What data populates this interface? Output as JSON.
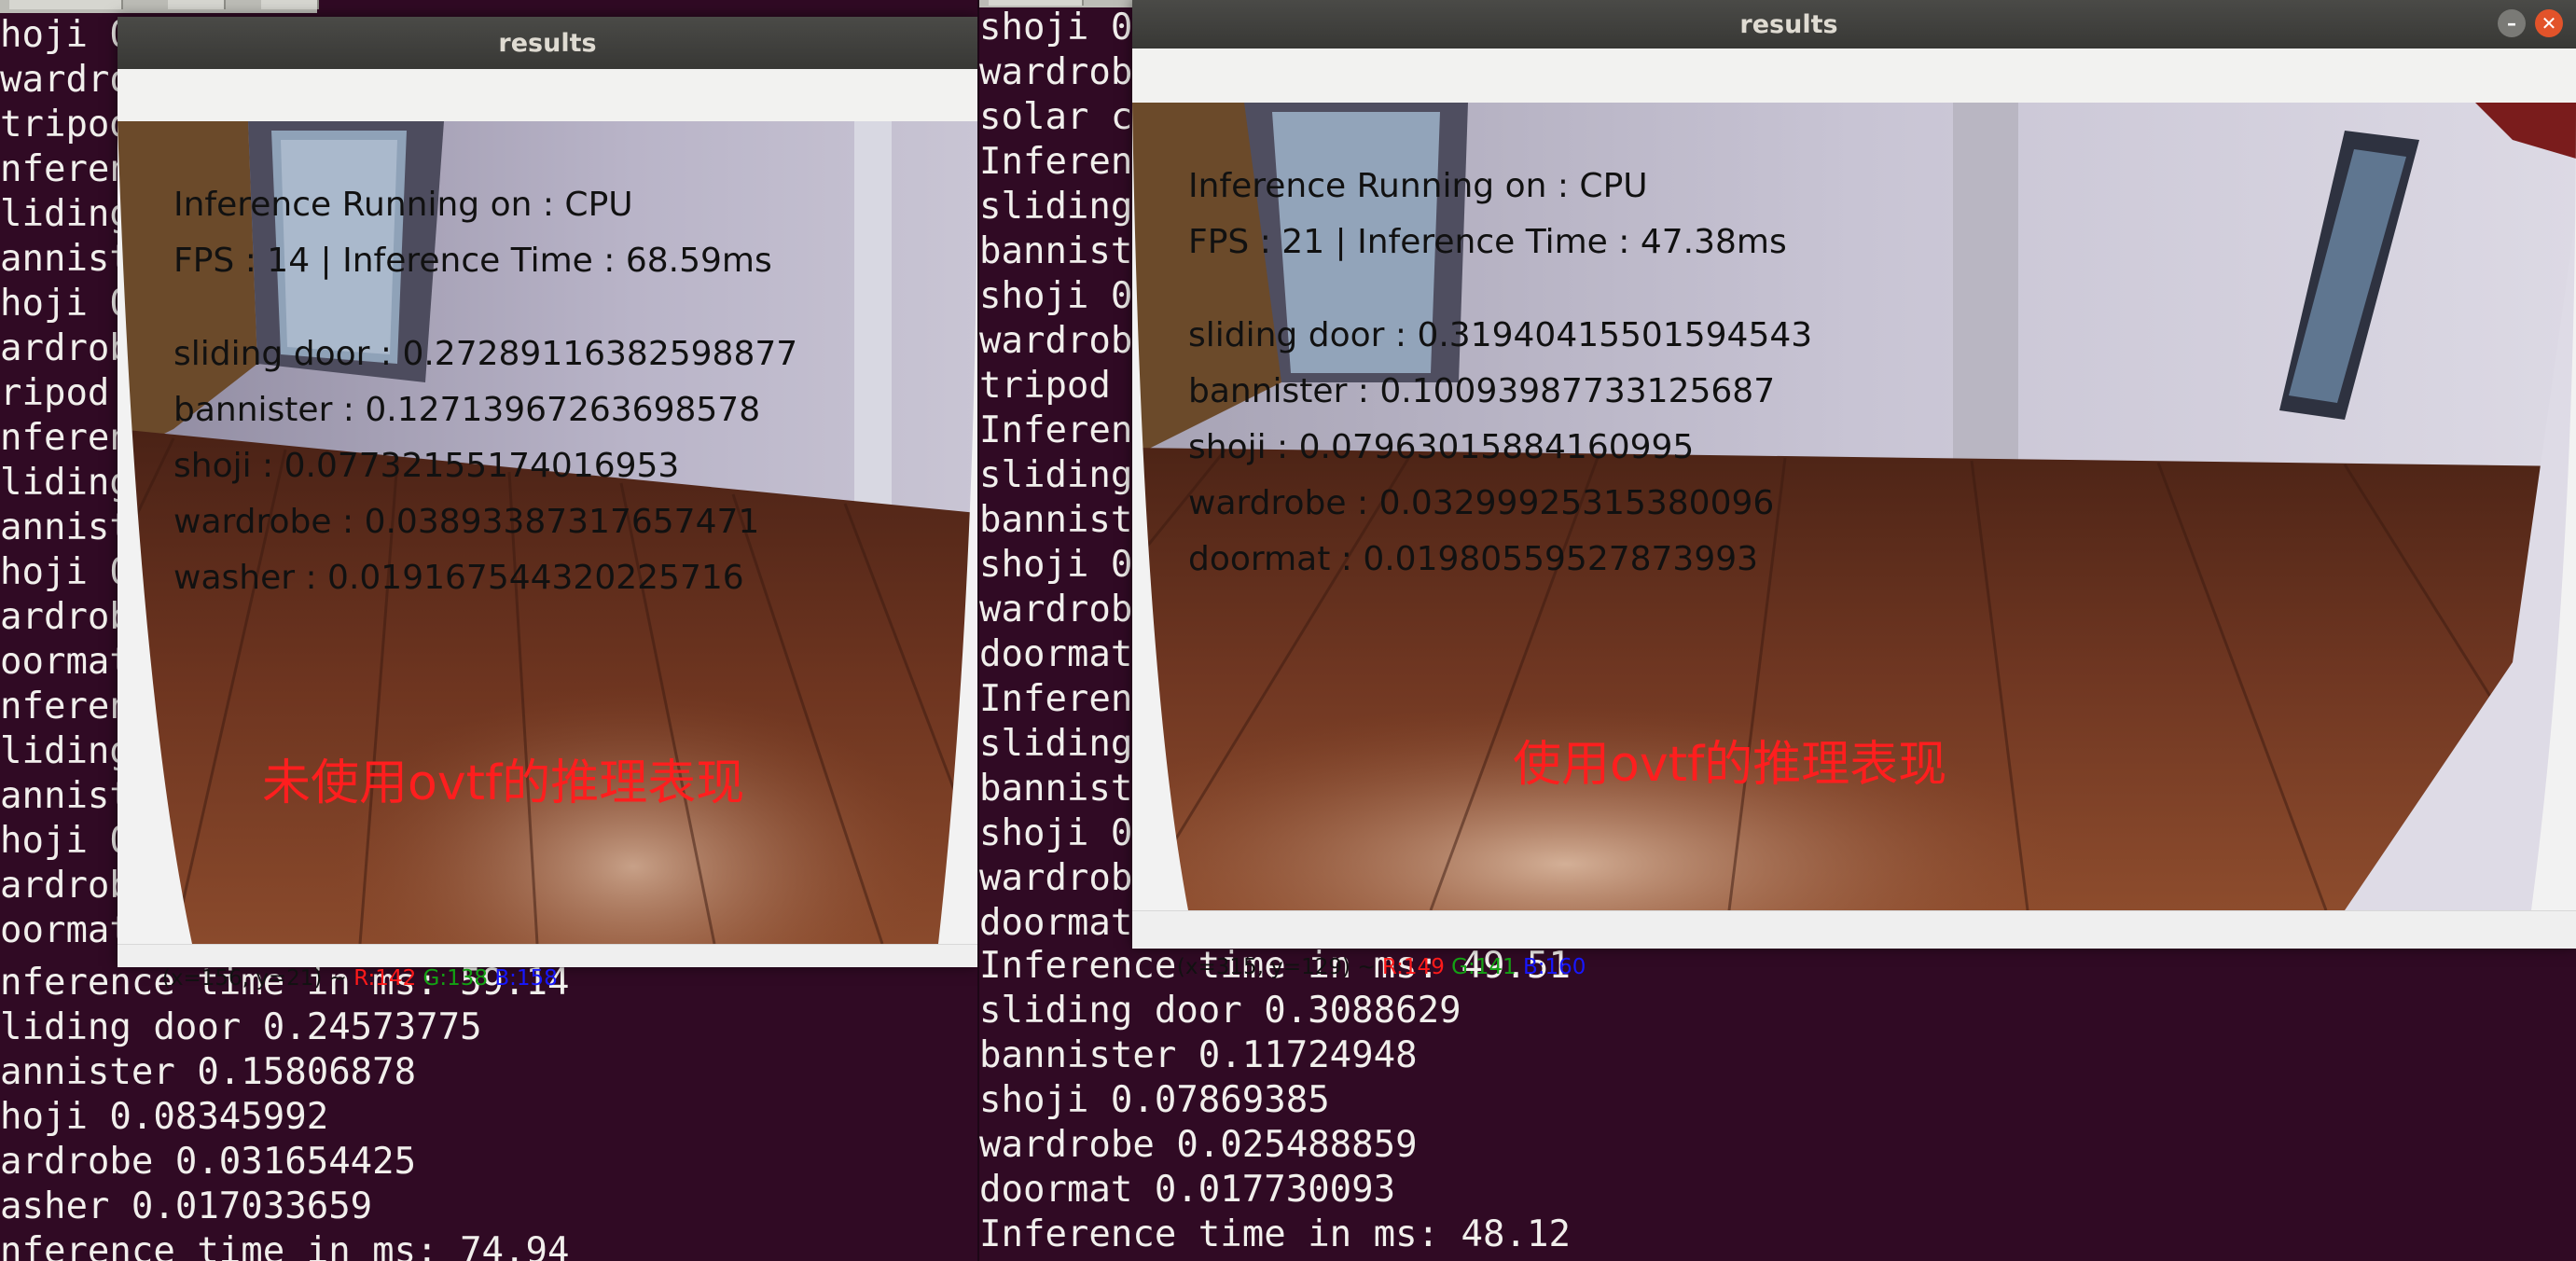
{
  "colors": {
    "terminal_bg": "#300a24",
    "terminal_text": "#f1efec",
    "caption": "#ff1e1e",
    "red_channel": "#ff1a1a",
    "green_channel": "#13a113",
    "blue_channel": "#1717ff"
  },
  "left_terminal": {
    "lines_under_window": [
      "hoji 0",
      "wardrob",
      "tripod",
      "nferen",
      "liding",
      "annist",
      "hoji 0",
      "ardrob",
      "ripod",
      "nferen",
      "liding",
      "annist",
      "hoji 0",
      "ardrob",
      "oormat",
      "nferen",
      "liding",
      "annist",
      "hoji 0",
      "ardrob",
      "oormat"
    ],
    "lines_below_window": [
      "nference time in ms: 59.14",
      "liding door 0.24573775",
      "annister 0.15806878",
      "hoji 0.08345992",
      "ardrobe 0.031654425",
      "asher 0.017033659",
      "nference time in ms: 74.94"
    ]
  },
  "right_terminal": {
    "lines_under_window": [
      "shoji 0",
      "wardrob",
      "solar c",
      "Inferen",
      "sliding",
      "bannist",
      "shoji 0",
      "wardrob",
      "tripod",
      "Inferen",
      "sliding",
      "bannist",
      "shoji 0",
      "wardrob",
      "doormat",
      "Inferen",
      "sliding",
      "bannist",
      "shoji 0",
      "wardrob",
      "doormat"
    ],
    "lines_below_window": [
      "Inference time in ms: 49.51",
      "sliding door 0.3088629",
      "bannister 0.11724948",
      "shoji 0.07869385",
      "wardrobe 0.025488859",
      "doormat 0.017730093",
      "Inference time in ms: 48.12"
    ]
  },
  "window_left": {
    "title": "results",
    "overlay": {
      "device_line": "Inference Running on : CPU",
      "fps_line": "FPS : 14 | Inference Time : 68.59ms",
      "results": [
        "sliding door : 0.27289116382598877",
        "bannister : 0.12713967263698578",
        "shoji : 0.07732155174016953",
        "wardrobe : 0.03893387317657471",
        "washer : 0.019167544320225716"
      ],
      "caption": "未使用ovtf的推理表现"
    },
    "status": {
      "coords": "(x=156, y=21) ~ ",
      "r": "R:142",
      "g": "G:138",
      "b": "B:158"
    }
  },
  "window_right": {
    "title": "results",
    "overlay": {
      "device_line": "Inference Running on : CPU",
      "fps_line": "FPS : 21 | Inference Time : 47.38ms",
      "results": [
        "sliding door : 0.31940415501594543",
        "bannister : 0.10093987733125687",
        "shoji : 0.07963015884160995",
        "wardrobe : 0.03299925315380096",
        "doormat : 0.01980559527873993"
      ],
      "caption": "使用ovtf的推理表现"
    },
    "status": {
      "coords": "(x=315, y=129) ~ ",
      "r": "R:149",
      "g": "G:141",
      "b": "B:160"
    },
    "buttons": {
      "minimize_glyph": "–",
      "close_glyph": "✕"
    }
  }
}
